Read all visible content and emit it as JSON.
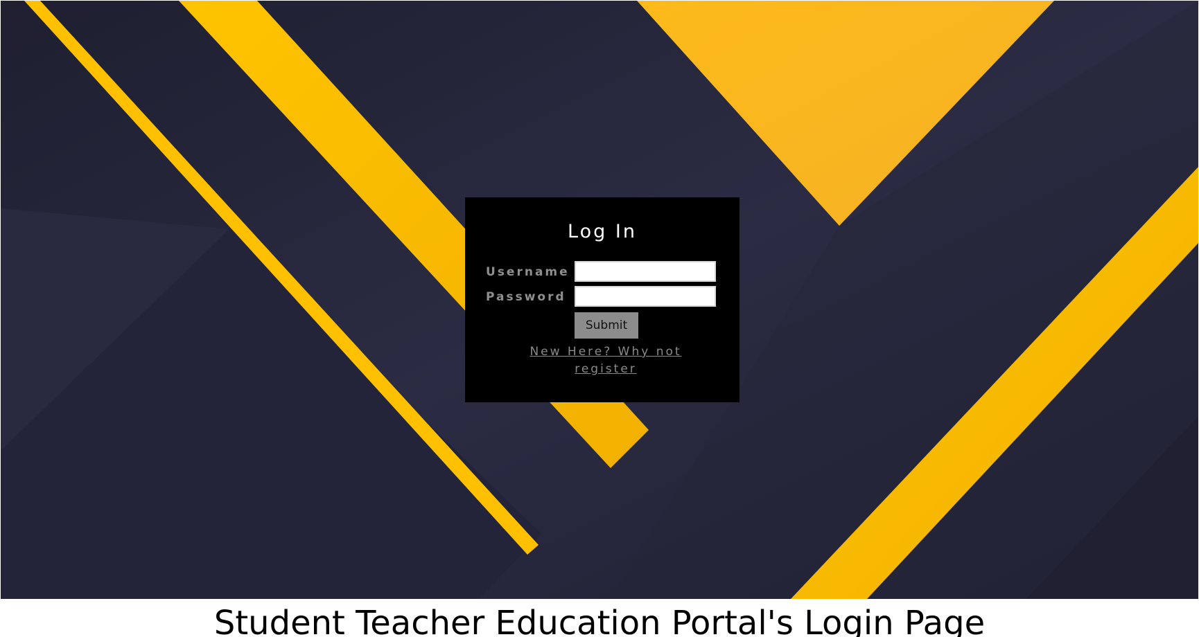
{
  "login": {
    "title": "Log In",
    "username_label": "Username",
    "password_label": "Password",
    "username_value": "",
    "password_value": "",
    "submit_label": "Submit",
    "register_link": "New Here? Why not register"
  },
  "caption": {
    "text": "Student Teacher Education Portal's Login Page"
  },
  "colors": {
    "background_navy": "#2a2a40",
    "accent_yellow": "#fbc000",
    "login_box": "#000000",
    "submit_button": "#8c8c8c"
  }
}
